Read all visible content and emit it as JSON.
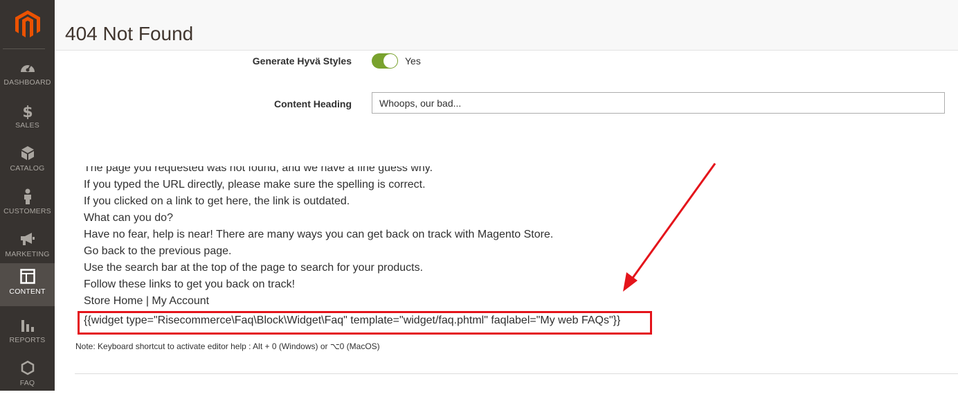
{
  "sidebar": {
    "items": [
      {
        "label": "DASHBOARD",
        "icon": "gauge-icon"
      },
      {
        "label": "SALES",
        "icon": "dollar-icon"
      },
      {
        "label": "CATALOG",
        "icon": "cube-icon"
      },
      {
        "label": "CUSTOMERS",
        "icon": "person-icon"
      },
      {
        "label": "MARKETING",
        "icon": "megaphone-icon"
      },
      {
        "label": "CONTENT",
        "icon": "layout-icon",
        "active": true
      },
      {
        "label": "REPORTS",
        "icon": "bar-chart-icon"
      },
      {
        "label": "FAQ",
        "icon": "hexagon-icon"
      }
    ]
  },
  "header": {
    "title": "404 Not Found"
  },
  "form": {
    "hyva_label": "Generate Hyvä Styles",
    "hyva_value": "Yes",
    "heading_label": "Content Heading",
    "heading_value": "Whoops, our bad..."
  },
  "editor": {
    "lines": [
      "The page you requested was not found, and we have a fine guess why.",
      "If you typed the URL directly, please make sure the spelling is correct.",
      "If you clicked on a link to get here, the link is outdated.",
      "What can you do?",
      "Have no fear, help is near! There are many ways you can get back on track with Magento Store.",
      "Go back to the previous page.",
      "Use the search bar at the top of the page to search for your products.",
      "Follow these links to get you back on track!"
    ],
    "store_home": "Store Home",
    "separator": " | ",
    "my_account": "My Account",
    "widget": "{{widget type=\"Risecommerce\\Faq\\Block\\Widget\\Faq\" template=\"widget/faq.phtml\" faqlabel=\"My web FAQs\"}}"
  },
  "note": "Note: Keyboard shortcut to activate editor help : Alt + 0 (Windows) or ⌥0 (MacOS)",
  "colors": {
    "sidebar": "#373330",
    "accent": "#eb5202",
    "toggle": "#79a22e",
    "highlight": "#e4141b"
  }
}
